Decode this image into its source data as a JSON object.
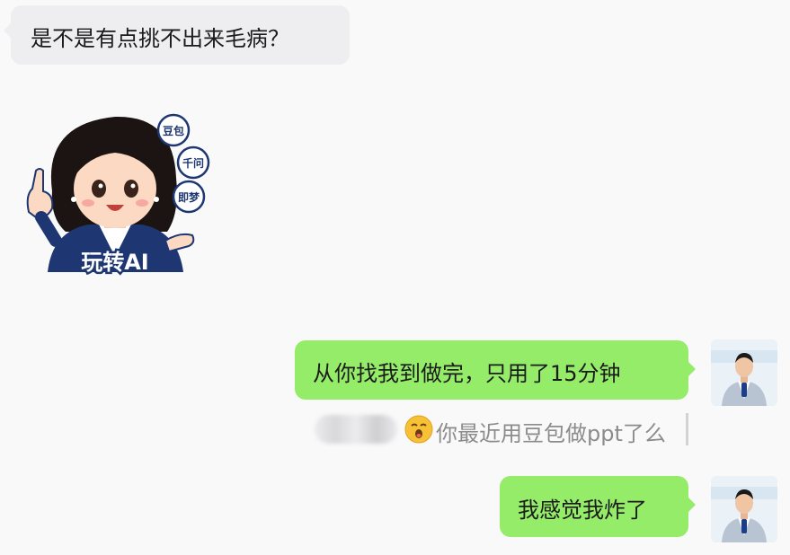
{
  "messages": [
    {
      "id": "m1",
      "side": "left",
      "type": "text",
      "text": "是不是有点挑不出来毛病？"
    },
    {
      "id": "m2",
      "side": "left",
      "type": "sticker",
      "sticker_text": "玩转AI",
      "badges": [
        "豆包",
        "千问",
        "即梦"
      ]
    },
    {
      "id": "m3",
      "side": "right",
      "type": "text",
      "text": "从你找我到做完，只用了15分钟"
    },
    {
      "id": "m4",
      "side": "right",
      "type": "text",
      "text": "我感觉我炸了"
    }
  ],
  "quote": {
    "text": "你最近用豆包做ppt了么"
  },
  "colors": {
    "background": "#f9f9fa",
    "left_bubble": "#eeeef0",
    "right_bubble": "#95ec69",
    "quote_text": "#8c8c8c",
    "sticker_blue": "#1e3772"
  }
}
